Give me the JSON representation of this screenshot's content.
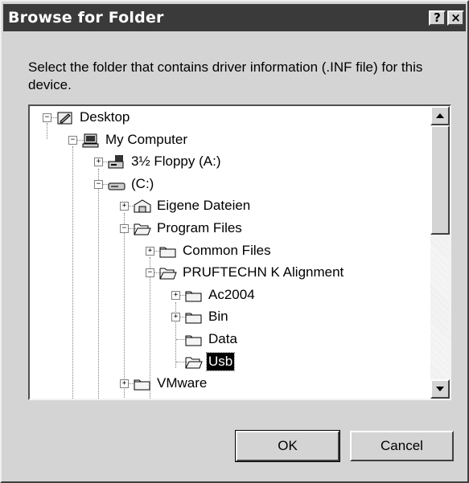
{
  "window": {
    "title": "Browse for Folder",
    "help_label": "?",
    "close_label": "×"
  },
  "instruction": "Select the folder that contains driver information (.INF file) for this device.",
  "tree": {
    "selected": "Usb",
    "items": [
      {
        "label": "Desktop",
        "icon": "desktop-icon",
        "expander": "minus"
      },
      {
        "label": "My Computer",
        "icon": "computer-icon",
        "expander": "minus"
      },
      {
        "label": "3½ Floppy (A:)",
        "icon": "floppy-drive-icon",
        "expander": "plus"
      },
      {
        "label": "(C:)",
        "icon": "hard-drive-icon",
        "expander": "minus"
      },
      {
        "label": "Eigene Dateien",
        "icon": "special-folder-icon",
        "expander": "plus"
      },
      {
        "label": "Program Files",
        "icon": "open-folder-icon",
        "expander": "minus"
      },
      {
        "label": "Common Files",
        "icon": "folder-icon",
        "expander": "plus"
      },
      {
        "label": "PRUFTECHN K Alignment",
        "icon": "open-folder-icon",
        "expander": "minus"
      },
      {
        "label": "Ac2004",
        "icon": "folder-icon",
        "expander": "plus"
      },
      {
        "label": "Bin",
        "icon": "folder-icon",
        "expander": "plus"
      },
      {
        "label": "Data",
        "icon": "folder-icon",
        "expander": "none"
      },
      {
        "label": "Usb",
        "icon": "open-folder-icon",
        "expander": "none"
      },
      {
        "label": "VMware",
        "icon": "folder-icon",
        "expander": "plus"
      }
    ]
  },
  "scrollbar": {
    "up_icon": "scroll-up-arrow-icon",
    "down_icon": "scroll-down-arrow-icon"
  },
  "buttons": {
    "ok": "OK",
    "cancel": "Cancel"
  }
}
